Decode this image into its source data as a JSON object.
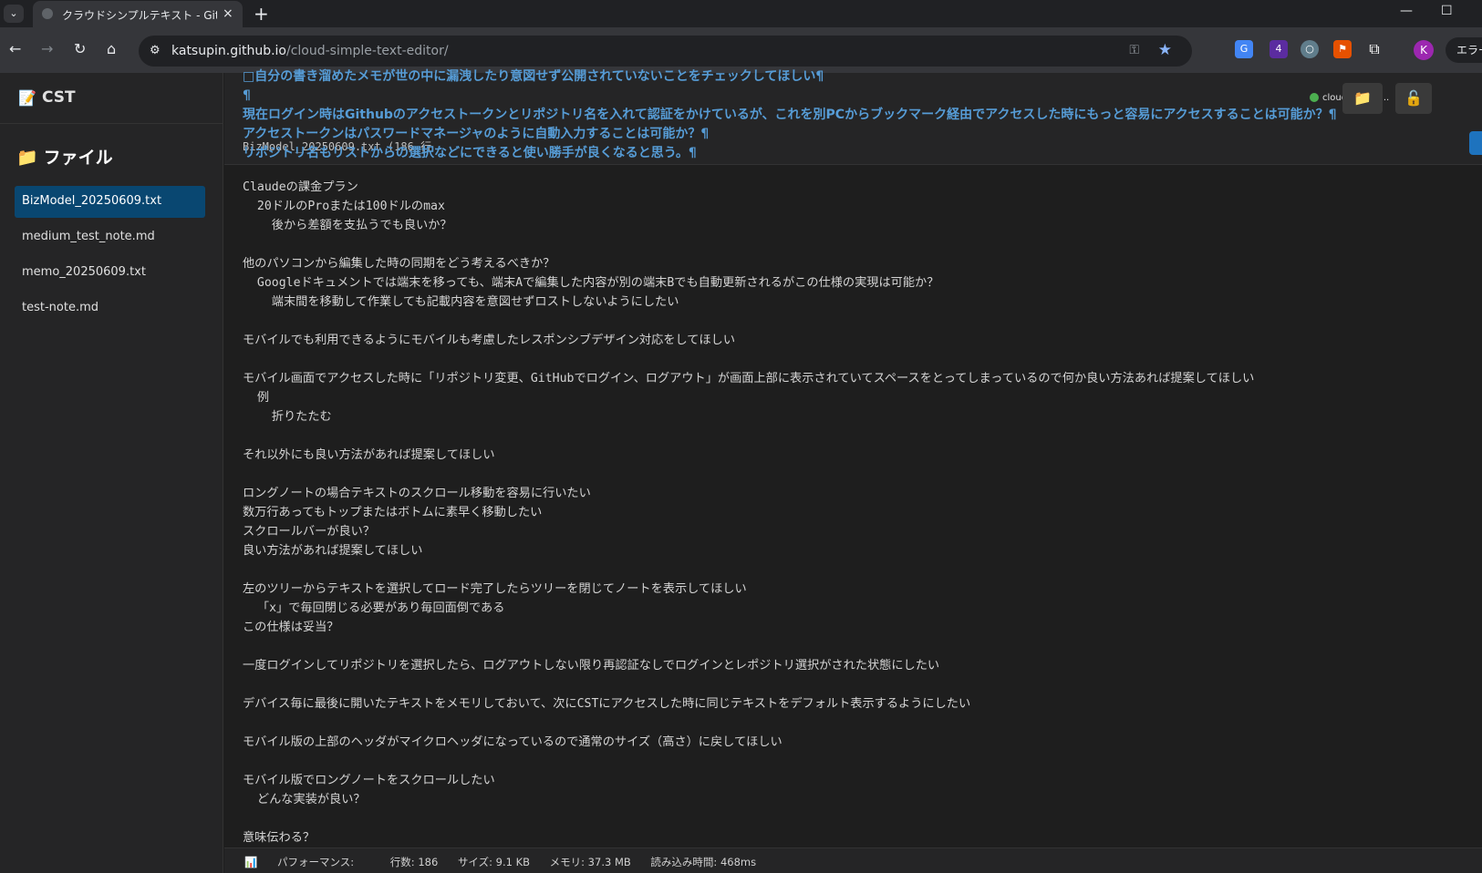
{
  "browser": {
    "tab_title": "クラウドシンプルテキスト - GitHub連",
    "tab_close": "×",
    "new_tab": "+",
    "url_host": "katsupin.github.io",
    "url_path": "/cloud-simple-text-editor/",
    "profile_initial": "K",
    "error_button": "エラー",
    "ext_badge": "4"
  },
  "app": {
    "brand": "CST",
    "files_heading": "ファイル",
    "files": [
      {
        "name": "BizModel_20250609.txt",
        "active": true
      },
      {
        "name": "medium_test_note.md",
        "active": false
      },
      {
        "name": "memo_20250609.txt",
        "active": false
      },
      {
        "name": "test-note.md",
        "active": false
      }
    ],
    "repo_label": "cloud-simple...",
    "file_meta": "BizModel_20250609.txt (186 行",
    "overlay_lines": [
      "□自分の書き溜めたメモが世の中に漏洩したり意図せず公開されていないことをチェックしてほしい¶",
      "¶",
      "現在ログイン時はGithubのアクセストークンとリポジトリ名を入れて認証をかけているが、これを別PCからブックマーク経由でアクセスした時にもっと容易にアクセスすることは可能か？¶",
      "アクセストークンはパスワードマネージャのように自動入力することは可能か？¶",
      "リポジトリ名もリストからの選択などにできると使い勝手が良くなると思う。¶"
    ],
    "editor_lines": [
      "Claudeの課金プラン",
      "  20ドルのProまたは100ドルのmax",
      "    後から差額を支払うでも良いか？",
      "",
      "他のパソコンから編集した時の同期をどう考えるべきか？",
      "  Googleドキュメントでは端末を移っても、端末Aで編集した内容が別の端末Bでも自動更新されるがこの仕様の実現は可能か？",
      "    端末間を移動して作業しても記載内容を意図せずロストしないようにしたい",
      "",
      "モバイルでも利用できるようにモバイルも考慮したレスポンシブデザイン対応をしてほしい",
      "",
      "モバイル画面でアクセスした時に「リポジトリ変更、GitHubでログイン、ログアウト」が画面上部に表示されていてスペースをとってしまっているので何か良い方法あれば提案してほしい",
      "  例",
      "    折りたたむ",
      "",
      "それ以外にも良い方法があれば提案してほしい",
      "",
      "ロングノートの場合テキストのスクロール移動を容易に行いたい",
      "数万行あってもトップまたはボトムに素早く移動したい",
      "スクロールバーが良い？",
      "良い方法があれば提案してほしい",
      "",
      "左のツリーからテキストを選択してロード完了したらツリーを閉じてノートを表示してほしい",
      "  「x」で毎回閉じる必要があり毎回面倒である",
      "この仕様は妥当？",
      "",
      "一度ログインしてリポジトリを選択したら、ログアウトしない限り再認証なしでログインとレポジトリ選択がされた状態にしたい",
      "",
      "デバイス毎に最後に開いたテキストをメモリしておいて、次にCSTにアクセスした時に同じテキストをデフォルト表示するようにしたい",
      "",
      "モバイル版の上部のヘッダがマイクロヘッダになっているので通常のサイズ（高さ）に戻してほしい",
      "",
      "モバイル版でロングノートをスクロールしたい",
      "  どんな実装が良い？",
      "",
      "意味伝わる？"
    ],
    "status": {
      "perf_label": "パフォーマンス:",
      "lines": "行数: 186",
      "size": "サイズ: 9.1 KB",
      "memory": "メモリ: 37.3 MB",
      "load_time": "読み込み時間: 468ms"
    }
  },
  "colors": {
    "accent": "#094771",
    "overlay_text": "#569cd6",
    "editor_bg": "#1e1e1e"
  }
}
